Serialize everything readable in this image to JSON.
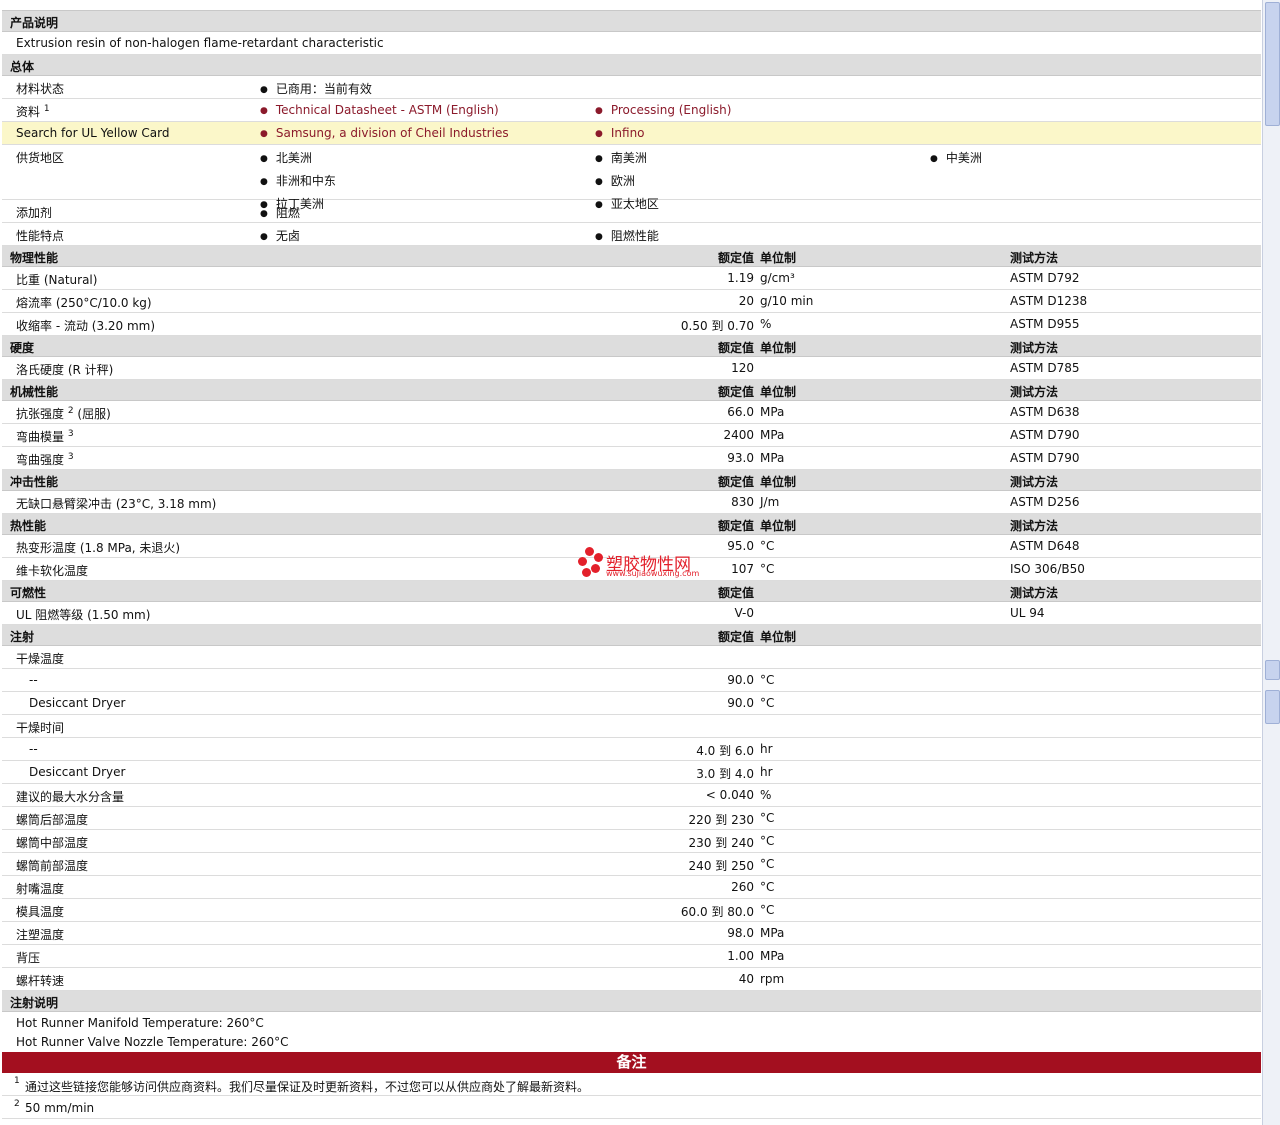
{
  "product_desc": {
    "title": "产品说明",
    "text": "Extrusion resin of non-halogen flame-retardant characteristic"
  },
  "general": {
    "title": "总体",
    "material_status_label": "材料状态",
    "material_status_value": "已商用：当前有效",
    "docs_label": "资料",
    "docs_sup": "1",
    "docs_link1": "Technical Datasheet - ASTM (English)",
    "docs_link2": "Processing (English)",
    "ul_label": "Search for UL Yellow Card",
    "ul_link1": "Samsung, a division of Cheil Industries",
    "ul_link2": "Infino",
    "supply_label": "供货地区",
    "supply_col1": [
      "北美洲",
      "非洲和中东",
      "拉丁美洲"
    ],
    "supply_col2": [
      "南美洲",
      "欧洲",
      "亚太地区"
    ],
    "supply_col3": [
      "中美洲"
    ],
    "additive_label": "添加剂",
    "additive_value": "阻燃",
    "feature_label": "性能特点",
    "feature_value1": "无卤",
    "feature_value2": "阻燃性能"
  },
  "headers": {
    "value": "额定值",
    "unit": "单位制",
    "test": "测试方法"
  },
  "physical": {
    "title": "物理性能",
    "rows": [
      {
        "label": "比重 (Natural)",
        "value": "1.19",
        "unit": "g/cm³",
        "test": "ASTM D792"
      },
      {
        "label": "熔流率 (250°C/10.0 kg)",
        "value": "20",
        "unit": "g/10 min",
        "test": "ASTM D1238"
      },
      {
        "label": "收缩率 - 流动 (3.20 mm)",
        "value": "0.50 到  0.70",
        "unit": "%",
        "test": "ASTM D955"
      }
    ]
  },
  "hardness": {
    "title": "硬度",
    "rows": [
      {
        "label": "洛氏硬度 (R 计秤)",
        "value": "120",
        "unit": "",
        "test": "ASTM D785"
      }
    ]
  },
  "mechanical": {
    "title": "机械性能",
    "rows": [
      {
        "label": "抗张强度",
        "sup": "2",
        "label2": "(屈服)",
        "value": "66.0",
        "unit": "MPa",
        "test": "ASTM D638"
      },
      {
        "label": "弯曲模量",
        "sup": "3",
        "label2": "",
        "value": "2400",
        "unit": "MPa",
        "test": "ASTM D790"
      },
      {
        "label": "弯曲强度",
        "sup": "3",
        "label2": "",
        "value": "93.0",
        "unit": "MPa",
        "test": "ASTM D790"
      }
    ]
  },
  "impact": {
    "title": "冲击性能",
    "rows": [
      {
        "label": "无缺口悬臂梁冲击 (23°C, 3.18 mm)",
        "value": "830",
        "unit": "J/m",
        "test": "ASTM D256"
      }
    ]
  },
  "thermal": {
    "title": "热性能",
    "rows": [
      {
        "label": "热变形温度 (1.8 MPa, 未退火)",
        "value": "95.0",
        "unit": "°C",
        "test": "ASTM D648"
      },
      {
        "label": "维卡软化温度",
        "value": "107",
        "unit": "°C",
        "test": "ISO 306/B50"
      }
    ]
  },
  "flammability": {
    "title": "可燃性",
    "rows": [
      {
        "label": "UL 阻燃等级 (1.50 mm)",
        "value": "V-0",
        "unit": "",
        "test": "UL 94"
      }
    ]
  },
  "injection": {
    "title": "注射",
    "rows": [
      {
        "label": "干燥温度",
        "value": "",
        "unit": "",
        "sub": false
      },
      {
        "label": "--",
        "value": "90.0",
        "unit": "°C",
        "sub": true
      },
      {
        "label": "Desiccant Dryer",
        "value": "90.0",
        "unit": "°C",
        "sub": true
      },
      {
        "label": "干燥时间",
        "value": "",
        "unit": "",
        "sub": false
      },
      {
        "label": "--",
        "value": "4.0 到  6.0",
        "unit": "hr",
        "sub": true
      },
      {
        "label": "Desiccant Dryer",
        "value": "3.0 到  4.0",
        "unit": "hr",
        "sub": true
      },
      {
        "label": "建议的最大水分含量",
        "value": "< 0.040",
        "unit": "%",
        "sub": false
      },
      {
        "label": "螺筒后部温度",
        "value": "220 到  230",
        "unit": "°C",
        "sub": false
      },
      {
        "label": "螺筒中部温度",
        "value": "230 到  240",
        "unit": "°C",
        "sub": false
      },
      {
        "label": "螺筒前部温度",
        "value": "240 到  250",
        "unit": "°C",
        "sub": false
      },
      {
        "label": "射嘴温度",
        "value": "260",
        "unit": "°C",
        "sub": false
      },
      {
        "label": "模具温度",
        "value": "60.0 到  80.0",
        "unit": "°C",
        "sub": false
      },
      {
        "label": "注塑温度",
        "value": "98.0",
        "unit": "MPa",
        "sub": false
      },
      {
        "label": "背压",
        "value": "1.00",
        "unit": "MPa",
        "sub": false
      },
      {
        "label": "螺杆转速",
        "value": "40",
        "unit": "rpm",
        "sub": false
      }
    ]
  },
  "injection_notes": {
    "title": "注射说明",
    "line1": "Hot Runner Manifold Temperature: 260°C",
    "line2": "Hot Runner Valve Nozzle Temperature: 260°C"
  },
  "notes": {
    "title": "备注",
    "items": [
      {
        "num": "1",
        "text": "通过这些链接您能够访问供应商资料。我们尽量保证及时更新资料，不过您可以从供应商处了解最新资料。"
      },
      {
        "num": "2",
        "text": "50 mm/min"
      }
    ]
  },
  "watermark": {
    "name": "塑胶物性网",
    "url": "www.sujiaowuxing.com"
  }
}
